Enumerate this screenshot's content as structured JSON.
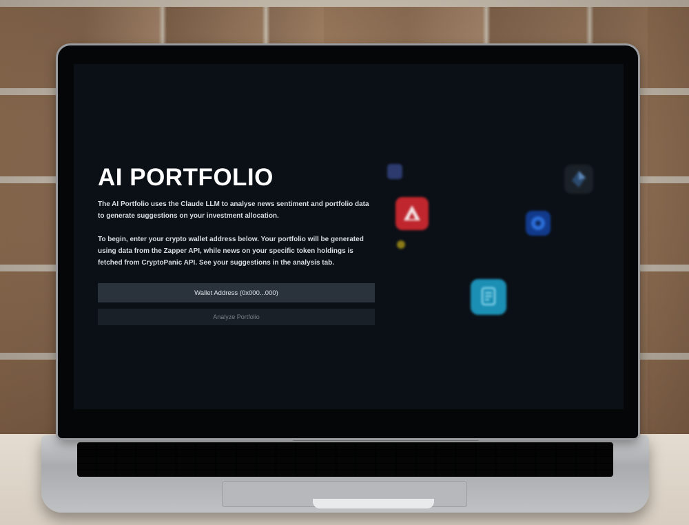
{
  "app": {
    "title": "AI PORTFOLIO",
    "description_1": "The AI Portfolio uses the Claude LLM to analyse news sentiment and portfolio data to generate suggestions on your investment allocation.",
    "description_2": "To begin, enter your crypto wallet address below. Your portfolio will be generated using data from the Zapper API, while news on your specific token holdings is fetched from CryptoPanic API. See your suggestions in the analysis tab."
  },
  "form": {
    "wallet_placeholder": "Wallet Address (0x000...000)",
    "analyze_label": "Analyze Portfolio"
  },
  "icons": {
    "token_1": "token-icon-blue-square",
    "token_2": "avalanche-icon",
    "token_3": "token-icon-yellow-dot",
    "token_4": "token-icon-dark-diamond",
    "token_5": "token-icon-blue-circle",
    "token_6": "document-token-icon"
  },
  "colors": {
    "screen_background": "#0b1016",
    "input_background": "#2a333c",
    "button_background": "#1a2027",
    "avalanche_red": "#c0262d",
    "cyan_accent": "#1c8fb5"
  }
}
